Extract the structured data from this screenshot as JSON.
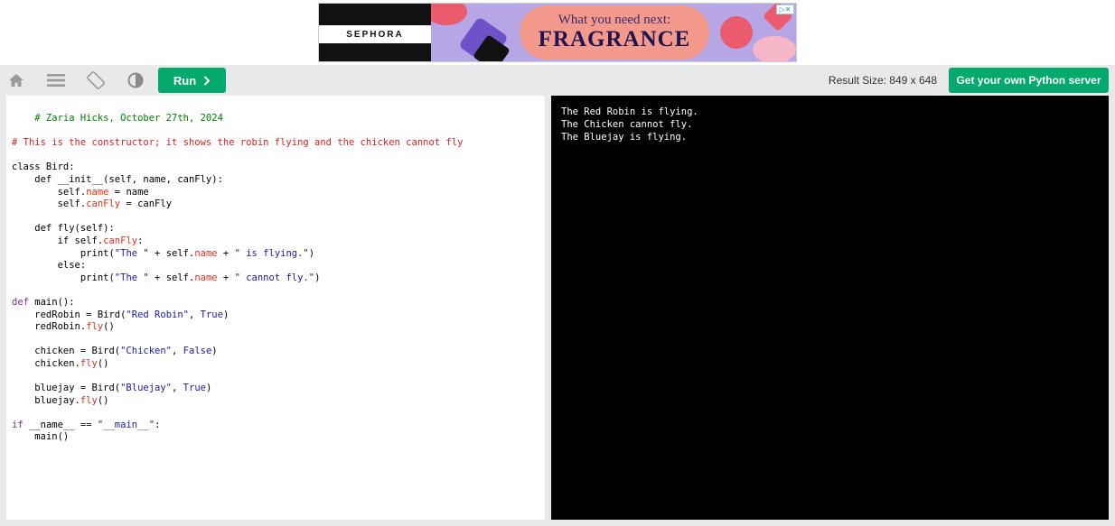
{
  "ad": {
    "brand": "SEPHORA",
    "tagline": "What you need next:",
    "headline": "FRAGRANCE",
    "choices_label": "▷✕"
  },
  "toolbar": {
    "icons": [
      "home-icon",
      "menu-icon",
      "rotate-icon",
      "contrast-icon"
    ],
    "run_label": "Run",
    "result_size": "Result Size: 849 x 648",
    "server_label": "Get your own Python server"
  },
  "code_lines": [
    [
      {
        "t": "    # Zaria Hicks, October 27th, 2024",
        "c": "tok-comment-green"
      }
    ],
    [],
    [
      {
        "t": "# This is the constructor; it shows the robin flying and the chicken cannot fly",
        "c": "tok-comment-red"
      }
    ],
    [],
    [
      {
        "t": "class Bird:",
        "c": ""
      }
    ],
    [
      {
        "t": "    def __init__(self, name, canFly):",
        "c": ""
      }
    ],
    [
      {
        "t": "        self.",
        "c": ""
      },
      {
        "t": "name",
        "c": "tok-attr"
      },
      {
        "t": " = name",
        "c": ""
      }
    ],
    [
      {
        "t": "        self.",
        "c": ""
      },
      {
        "t": "canFly",
        "c": "tok-attr"
      },
      {
        "t": " = canFly",
        "c": ""
      }
    ],
    [],
    [
      {
        "t": "    def fly(self):",
        "c": ""
      }
    ],
    [
      {
        "t": "        if self.",
        "c": ""
      },
      {
        "t": "canFly",
        "c": "tok-attr"
      },
      {
        "t": ":",
        "c": ""
      }
    ],
    [
      {
        "t": "            print(",
        "c": ""
      },
      {
        "t": "\"The \"",
        "c": "tok-str"
      },
      {
        "t": " + self.",
        "c": ""
      },
      {
        "t": "name",
        "c": "tok-attr"
      },
      {
        "t": " + ",
        "c": ""
      },
      {
        "t": "\" is flying.\"",
        "c": "tok-str"
      },
      {
        "t": ")",
        "c": ""
      }
    ],
    [
      {
        "t": "        else:",
        "c": ""
      }
    ],
    [
      {
        "t": "            print(",
        "c": ""
      },
      {
        "t": "\"The \"",
        "c": "tok-str"
      },
      {
        "t": " + self.",
        "c": ""
      },
      {
        "t": "name",
        "c": "tok-attr"
      },
      {
        "t": " + ",
        "c": ""
      },
      {
        "t": "\" cannot fly.\"",
        "c": "tok-str"
      },
      {
        "t": ")",
        "c": ""
      }
    ],
    [],
    [
      {
        "t": "def",
        "c": "tok-kw"
      },
      {
        "t": " main():",
        "c": ""
      }
    ],
    [
      {
        "t": "    redRobin = Bird(",
        "c": ""
      },
      {
        "t": "\"Red Robin\"",
        "c": "tok-str"
      },
      {
        "t": ", ",
        "c": ""
      },
      {
        "t": "True",
        "c": "tok-bool"
      },
      {
        "t": ")",
        "c": ""
      }
    ],
    [
      {
        "t": "    redRobin.",
        "c": ""
      },
      {
        "t": "fly",
        "c": "tok-attr"
      },
      {
        "t": "()",
        "c": ""
      }
    ],
    [],
    [
      {
        "t": "    chicken = Bird(",
        "c": ""
      },
      {
        "t": "\"Chicken\"",
        "c": "tok-str"
      },
      {
        "t": ", ",
        "c": ""
      },
      {
        "t": "False",
        "c": "tok-bool"
      },
      {
        "t": ")",
        "c": ""
      }
    ],
    [
      {
        "t": "    chicken.",
        "c": ""
      },
      {
        "t": "fly",
        "c": "tok-attr"
      },
      {
        "t": "()",
        "c": ""
      }
    ],
    [],
    [
      {
        "t": "    bluejay = Bird(",
        "c": ""
      },
      {
        "t": "\"Bluejay\"",
        "c": "tok-str"
      },
      {
        "t": ", ",
        "c": ""
      },
      {
        "t": "True",
        "c": "tok-bool"
      },
      {
        "t": ")",
        "c": ""
      }
    ],
    [
      {
        "t": "    bluejay.",
        "c": ""
      },
      {
        "t": "fly",
        "c": "tok-attr"
      },
      {
        "t": "()",
        "c": ""
      }
    ],
    [],
    [
      {
        "t": "if",
        "c": "tok-kw"
      },
      {
        "t": " __name__ == ",
        "c": ""
      },
      {
        "t": "\"__main__\"",
        "c": "tok-str"
      },
      {
        "t": ":",
        "c": ""
      }
    ],
    [
      {
        "t": "    main()",
        "c": ""
      }
    ]
  ],
  "output_lines": [
    "The Red Robin is flying.",
    "The Chicken cannot fly.",
    "The Bluejay is flying."
  ]
}
